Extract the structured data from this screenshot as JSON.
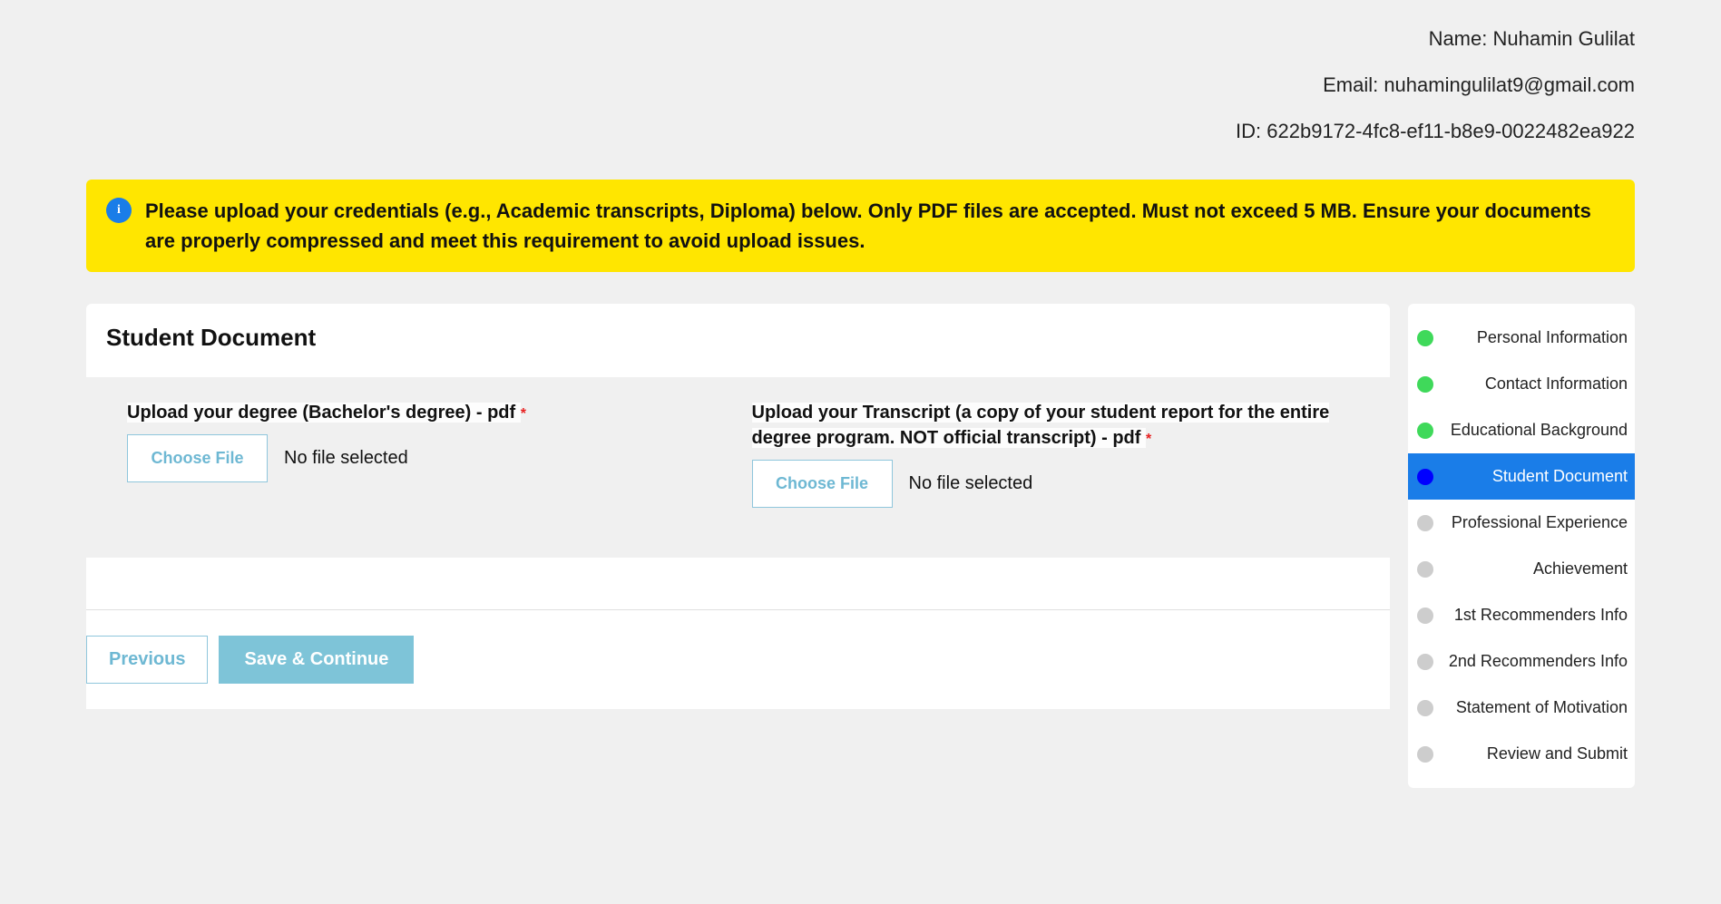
{
  "user": {
    "name_label": "Name: Nuhamin Gulilat",
    "email_label": "Email: nuhamingulilat9@gmail.com",
    "id_label": "ID: 622b9172-4fc8-ef11-b8e9-0022482ea922"
  },
  "alert": {
    "text": "Please upload your credentials (e.g., Academic transcripts, Diploma) below. Only PDF files are accepted. Must not exceed 5 MB. Ensure your documents are properly compressed and meet this requirement to avoid upload issues."
  },
  "panel": {
    "title": "Student Document"
  },
  "uploads": {
    "degree": {
      "label": "Upload your degree (Bachelor's degree) - pdf ",
      "button": "Choose File",
      "status": "No file selected"
    },
    "transcript": {
      "label": "Upload your Transcript (a copy of your student report for the entire degree program. NOT official transcript) - pdf ",
      "button": "Choose File",
      "status": "No file selected"
    }
  },
  "buttons": {
    "previous": "Previous",
    "save": "Save & Continue"
  },
  "asterisk": "*",
  "steps": [
    {
      "label": "Personal Information",
      "status": "done"
    },
    {
      "label": "Contact Information",
      "status": "done"
    },
    {
      "label": "Educational Background",
      "status": "done"
    },
    {
      "label": "Student Document",
      "status": "current"
    },
    {
      "label": "Professional Experience",
      "status": "pending"
    },
    {
      "label": "Achievement",
      "status": "pending"
    },
    {
      "label": "1st Recommenders Info",
      "status": "pending"
    },
    {
      "label": "2nd Recommenders Info",
      "status": "pending"
    },
    {
      "label": "Statement of Motivation",
      "status": "pending"
    },
    {
      "label": "Review and Submit",
      "status": "pending"
    }
  ]
}
